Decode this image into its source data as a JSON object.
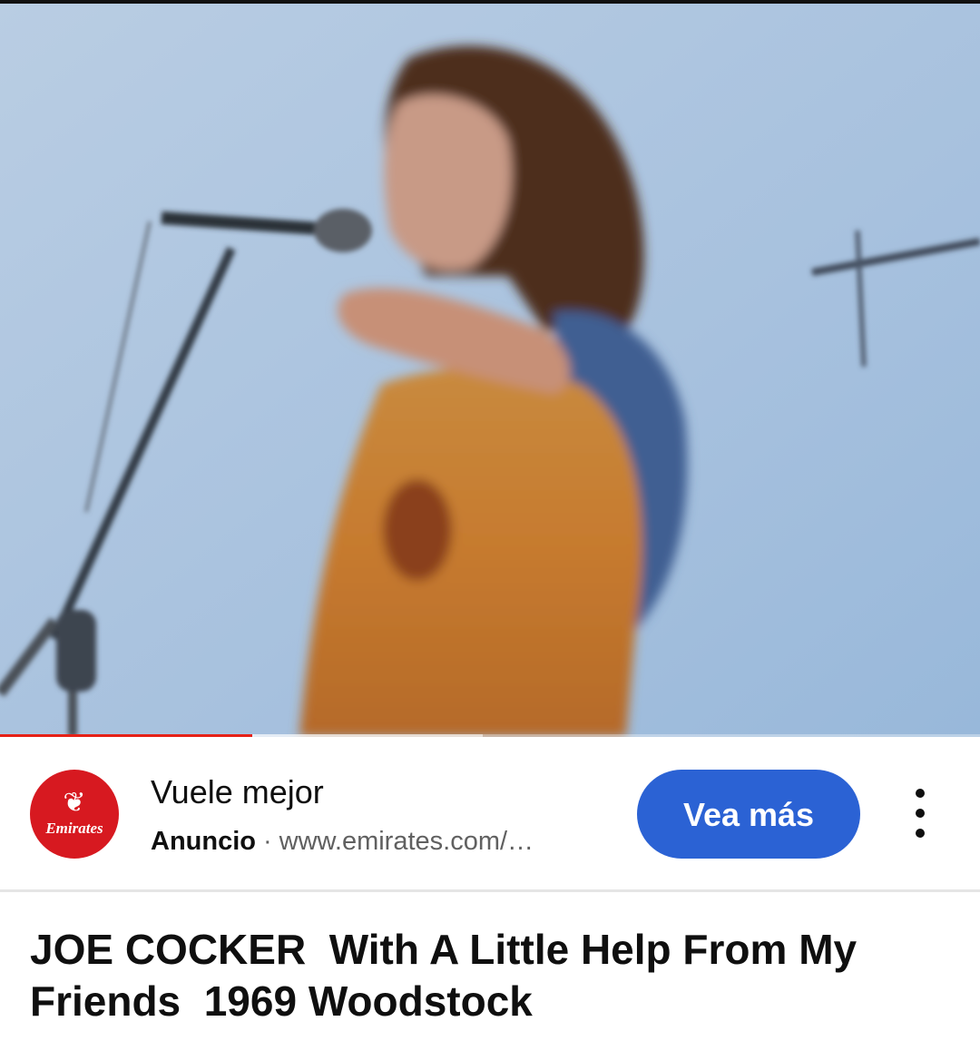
{
  "player": {
    "progress_played": 0.257,
    "progress_buffered": 0.493,
    "progress_color": "#e62117"
  },
  "ad": {
    "advertiser_logo_text": "Emirates",
    "headline": "Vuele mejor",
    "label": "Anuncio",
    "separator": "·",
    "url": "www.emirates.com/…",
    "cta_label": "Vea más",
    "cta_color": "#2b62d4",
    "more_icon": "vertical-ellipsis-icon"
  },
  "video": {
    "title": "JOE COCKER  With A Little Help From My Friends  1969 Woodstock"
  }
}
